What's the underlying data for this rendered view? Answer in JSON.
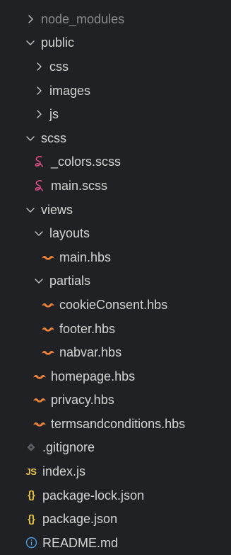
{
  "explorer": {
    "items": [
      {
        "label": "node_modules",
        "type": "folder",
        "expanded": false,
        "depth": 0,
        "dim": true
      },
      {
        "label": "public",
        "type": "folder",
        "expanded": true,
        "depth": 0
      },
      {
        "label": "css",
        "type": "folder",
        "expanded": false,
        "depth": 1
      },
      {
        "label": "images",
        "type": "folder",
        "expanded": false,
        "depth": 1
      },
      {
        "label": "js",
        "type": "folder",
        "expanded": false,
        "depth": 1
      },
      {
        "label": "scss",
        "type": "folder",
        "expanded": true,
        "depth": 0
      },
      {
        "label": "_colors.scss",
        "type": "file",
        "icon": "sass",
        "depth": 1
      },
      {
        "label": "main.scss",
        "type": "file",
        "icon": "sass",
        "depth": 1
      },
      {
        "label": "views",
        "type": "folder",
        "expanded": true,
        "depth": 0
      },
      {
        "label": "layouts",
        "type": "folder",
        "expanded": true,
        "depth": 1
      },
      {
        "label": "main.hbs",
        "type": "file",
        "icon": "handlebars",
        "depth": 2
      },
      {
        "label": "partials",
        "type": "folder",
        "expanded": true,
        "depth": 1
      },
      {
        "label": "cookieConsent.hbs",
        "type": "file",
        "icon": "handlebars",
        "depth": 2
      },
      {
        "label": "footer.hbs",
        "type": "file",
        "icon": "handlebars",
        "depth": 2
      },
      {
        "label": "nabvar.hbs",
        "type": "file",
        "icon": "handlebars",
        "depth": 2
      },
      {
        "label": "homepage.hbs",
        "type": "file",
        "icon": "handlebars",
        "depth": 1
      },
      {
        "label": "privacy.hbs",
        "type": "file",
        "icon": "handlebars",
        "depth": 1
      },
      {
        "label": "termsandconditions.hbs",
        "type": "file",
        "icon": "handlebars",
        "depth": 1
      },
      {
        "label": ".gitignore",
        "type": "file",
        "icon": "git",
        "depth": 0
      },
      {
        "label": "index.js",
        "type": "file",
        "icon": "js",
        "icon_text": "JS",
        "depth": 0
      },
      {
        "label": "package-lock.json",
        "type": "file",
        "icon": "json",
        "icon_text": "{}",
        "depth": 0
      },
      {
        "label": "package.json",
        "type": "file",
        "icon": "json",
        "icon_text": "{}",
        "depth": 0
      },
      {
        "label": "README.md",
        "type": "file",
        "icon": "info",
        "depth": 0
      }
    ]
  },
  "colors": {
    "background": "#202124",
    "text": "#d4d4d4",
    "dim_text": "#8b8b8b",
    "twisty": "#c5c5c5",
    "sass": "#e0508d",
    "handlebars": "#f0853a",
    "git": "#5a5f66",
    "js": "#e8c547",
    "json": "#e8c547",
    "info": "#4a9de0"
  }
}
